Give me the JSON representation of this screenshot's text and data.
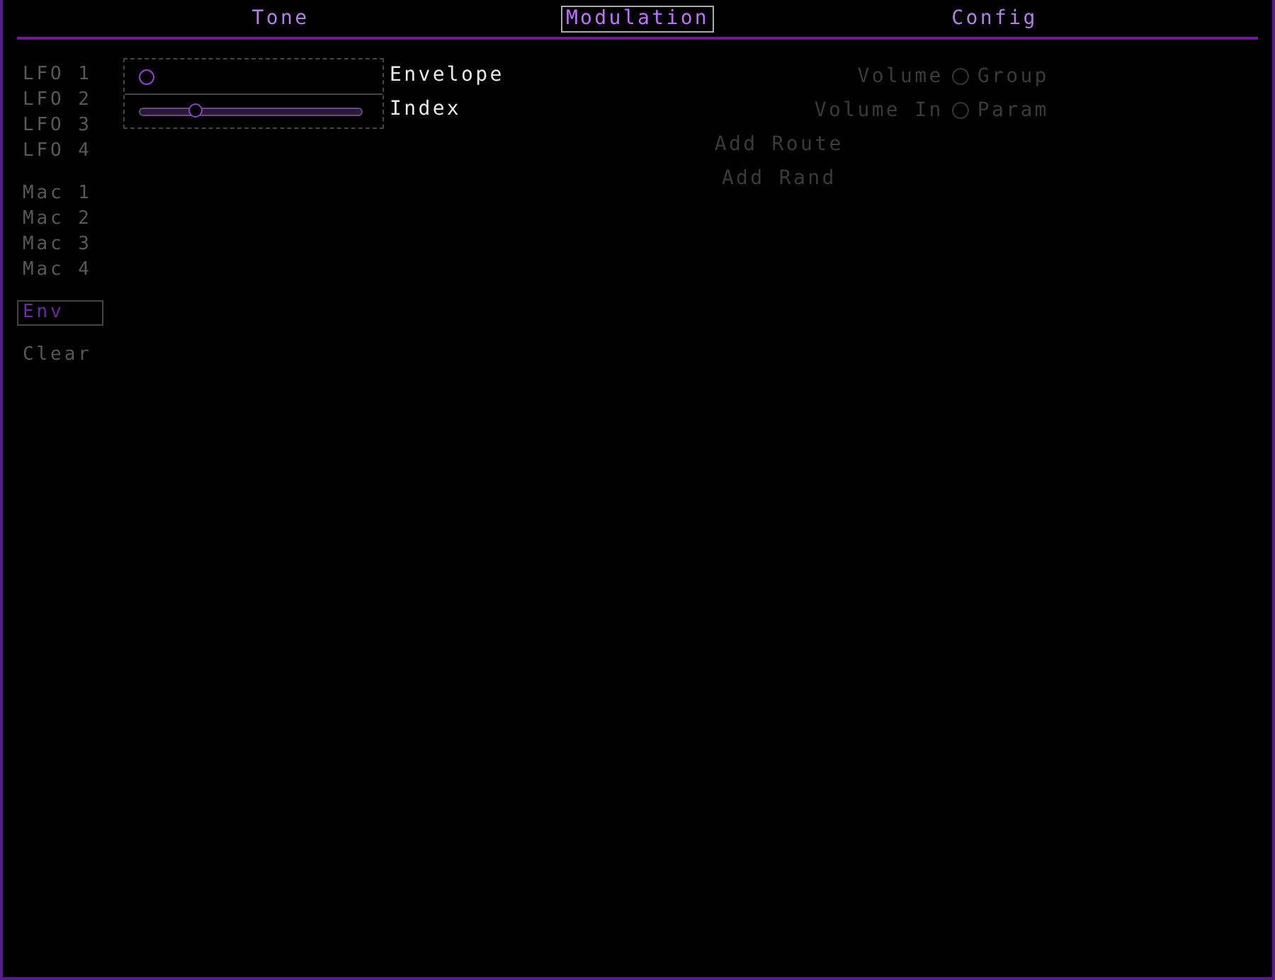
{
  "tabs": [
    {
      "label": "Tone",
      "selected": false
    },
    {
      "label": "Modulation",
      "selected": true
    },
    {
      "label": "Config",
      "selected": false
    }
  ],
  "sidebar": {
    "groups": [
      [
        {
          "label": "LFO 1",
          "selected": false
        },
        {
          "label": "LFO 2",
          "selected": false
        },
        {
          "label": "LFO 3",
          "selected": false
        },
        {
          "label": "LFO 4",
          "selected": false
        }
      ],
      [
        {
          "label": "Mac 1",
          "selected": false
        },
        {
          "label": "Mac 2",
          "selected": false
        },
        {
          "label": "Mac 3",
          "selected": false
        },
        {
          "label": "Mac 4",
          "selected": false
        }
      ],
      [
        {
          "label": "Env",
          "selected": true
        }
      ],
      [
        {
          "label": "Clear",
          "selected": false
        }
      ]
    ]
  },
  "params": [
    {
      "kind": "toggle",
      "label": "Envelope",
      "on": false
    },
    {
      "kind": "slider",
      "label": "Index",
      "level": 0.25
    }
  ],
  "routing": {
    "rows": [
      {
        "source": "Volume",
        "target": "Group",
        "selected": false
      },
      {
        "source": "Volume In",
        "target": "Param",
        "selected": false
      }
    ],
    "buttons": [
      "Add Route",
      "Add Rand"
    ]
  }
}
